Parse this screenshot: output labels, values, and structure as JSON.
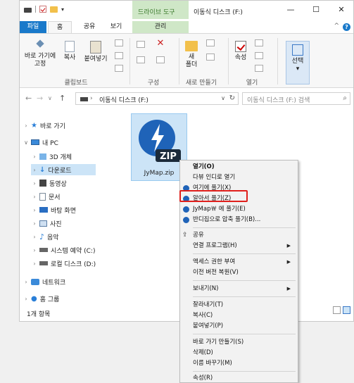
{
  "titlebar": {
    "context_tab": "드라이브 도구",
    "title": "이동식 디스크 (F:)",
    "minimize": "—",
    "maximize": "☐",
    "close": "✕"
  },
  "tabs": {
    "file": "파일",
    "home": "홈",
    "share": "공유",
    "view": "보기",
    "manage": "관리",
    "help": "?",
    "collapse": "^"
  },
  "ribbon": {
    "pin_label_1": "바로 가기에",
    "pin_label_2": "고정",
    "copy": "복사",
    "paste": "붙여넣기",
    "group_clipboard": "클립보드",
    "group_organize": "구성",
    "new_folder_1": "새",
    "new_folder_2": "폴더",
    "group_new": "새로 만들기",
    "properties": "속성",
    "group_open": "열기",
    "select": "선택"
  },
  "address": {
    "back": "←",
    "forward": "→",
    "recent": "∨",
    "up": "↑",
    "chev": "›",
    "path": "이동식 디스크 (F:)",
    "dropdown": "∨",
    "refresh": "↻",
    "search_placeholder": "이동식 디스크 (F:) 검색",
    "search_icon": "⌕"
  },
  "nav": {
    "items": [
      {
        "label": "바로 가기",
        "arrow": "›",
        "icon": "star-icon"
      },
      {
        "label": "내 PC",
        "arrow": "∨",
        "icon": "pc-icon"
      },
      {
        "label": "3D 개체",
        "arrow": "›",
        "icon": "3d-objects-icon"
      },
      {
        "label": "다운로드",
        "arrow": "›",
        "icon": "download-icon"
      },
      {
        "label": "동영상",
        "arrow": "›",
        "icon": "video-icon"
      },
      {
        "label": "문서",
        "arrow": "›",
        "icon": "document-icon"
      },
      {
        "label": "바탕 화면",
        "arrow": "›",
        "icon": "desktop-icon"
      },
      {
        "label": "사진",
        "arrow": "›",
        "icon": "pictures-icon"
      },
      {
        "label": "음악",
        "arrow": "›",
        "icon": "music-icon"
      },
      {
        "label": "시스템 예약 (C:)",
        "arrow": "›",
        "icon": "drive-icon"
      },
      {
        "label": "로컬 디스크 (D:)",
        "arrow": "›",
        "icon": "drive-icon"
      },
      {
        "label": "네트워크",
        "arrow": "›",
        "icon": "network-icon"
      },
      {
        "label": "홈 그룹",
        "arrow": "›",
        "icon": "homegroup-icon"
      }
    ]
  },
  "file": {
    "name": "JyMap.zip",
    "badge": "ZIP"
  },
  "status": {
    "count": "1개 항목"
  },
  "menu": {
    "items": [
      {
        "label": "열기(O)",
        "bold": true
      },
      {
        "label": "다뷰 인디로 열기"
      },
      {
        "label": "여기에 풀기(X)",
        "icon": "alzip-icon"
      },
      {
        "label": "알아서 풀기(Z)",
        "icon": "alzip-icon"
      },
      {
        "label": "JyMap￦ 에 풀기(E)",
        "icon": "alzip-icon"
      },
      {
        "label": "반디집으로 압축 풀기(B)...",
        "icon": "bandizip-icon"
      },
      {
        "label": "공유",
        "icon": "share-icon"
      },
      {
        "label": "연결 프로그램(H)",
        "sub": "▶"
      },
      {
        "label": "액세스 권한 부여",
        "sub": "▶"
      },
      {
        "label": "이전 버전 복원(V)"
      },
      {
        "label": "보내기(N)",
        "sub": "▶"
      },
      {
        "label": "잘라내기(T)"
      },
      {
        "label": "복사(C)"
      },
      {
        "label": "붙여넣기(P)"
      },
      {
        "label": "바로 가기 만들기(S)"
      },
      {
        "label": "삭제(D)"
      },
      {
        "label": "이름 바꾸기(M)"
      },
      {
        "label": "속성(R)"
      }
    ]
  },
  "colors": {
    "accent": "#1979ca",
    "context_tab": "#cfe7c7",
    "selection": "#cce4f7",
    "highlight_box": "#e0201c"
  }
}
